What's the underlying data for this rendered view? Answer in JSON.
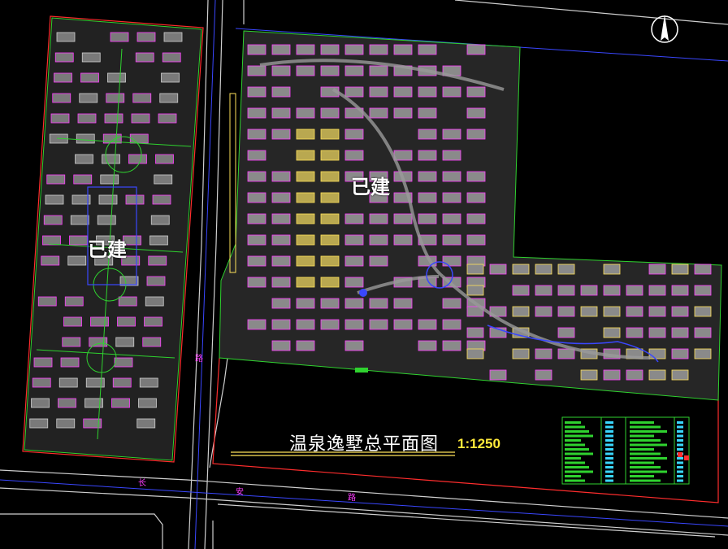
{
  "drawing": {
    "title": "温泉逸墅总平面图",
    "scale": "1:1250"
  },
  "labels": {
    "built_left": "已建",
    "built_right": "已建"
  },
  "road_chars": [
    {
      "text": "长",
      "id": "chang"
    },
    {
      "text": "安",
      "id": "an"
    },
    {
      "text": "路",
      "id": "lu-h"
    },
    {
      "text": "路",
      "id": "lu-v"
    }
  ],
  "icons": {
    "north_arrow": "north-arrow-icon"
  },
  "colors": {
    "background": "#000000",
    "site_boundary": "#ff2d2d",
    "road_line": "#3a47ff",
    "building_fill": "#c8c8c8",
    "building_outline": "#ff3cff",
    "green_line": "#2fd22f",
    "title_text": "#ffffff",
    "scale_text": "#ffea3a",
    "highlight_yellow": "#ffe25a",
    "legend_frame": "#2fd22f"
  }
}
